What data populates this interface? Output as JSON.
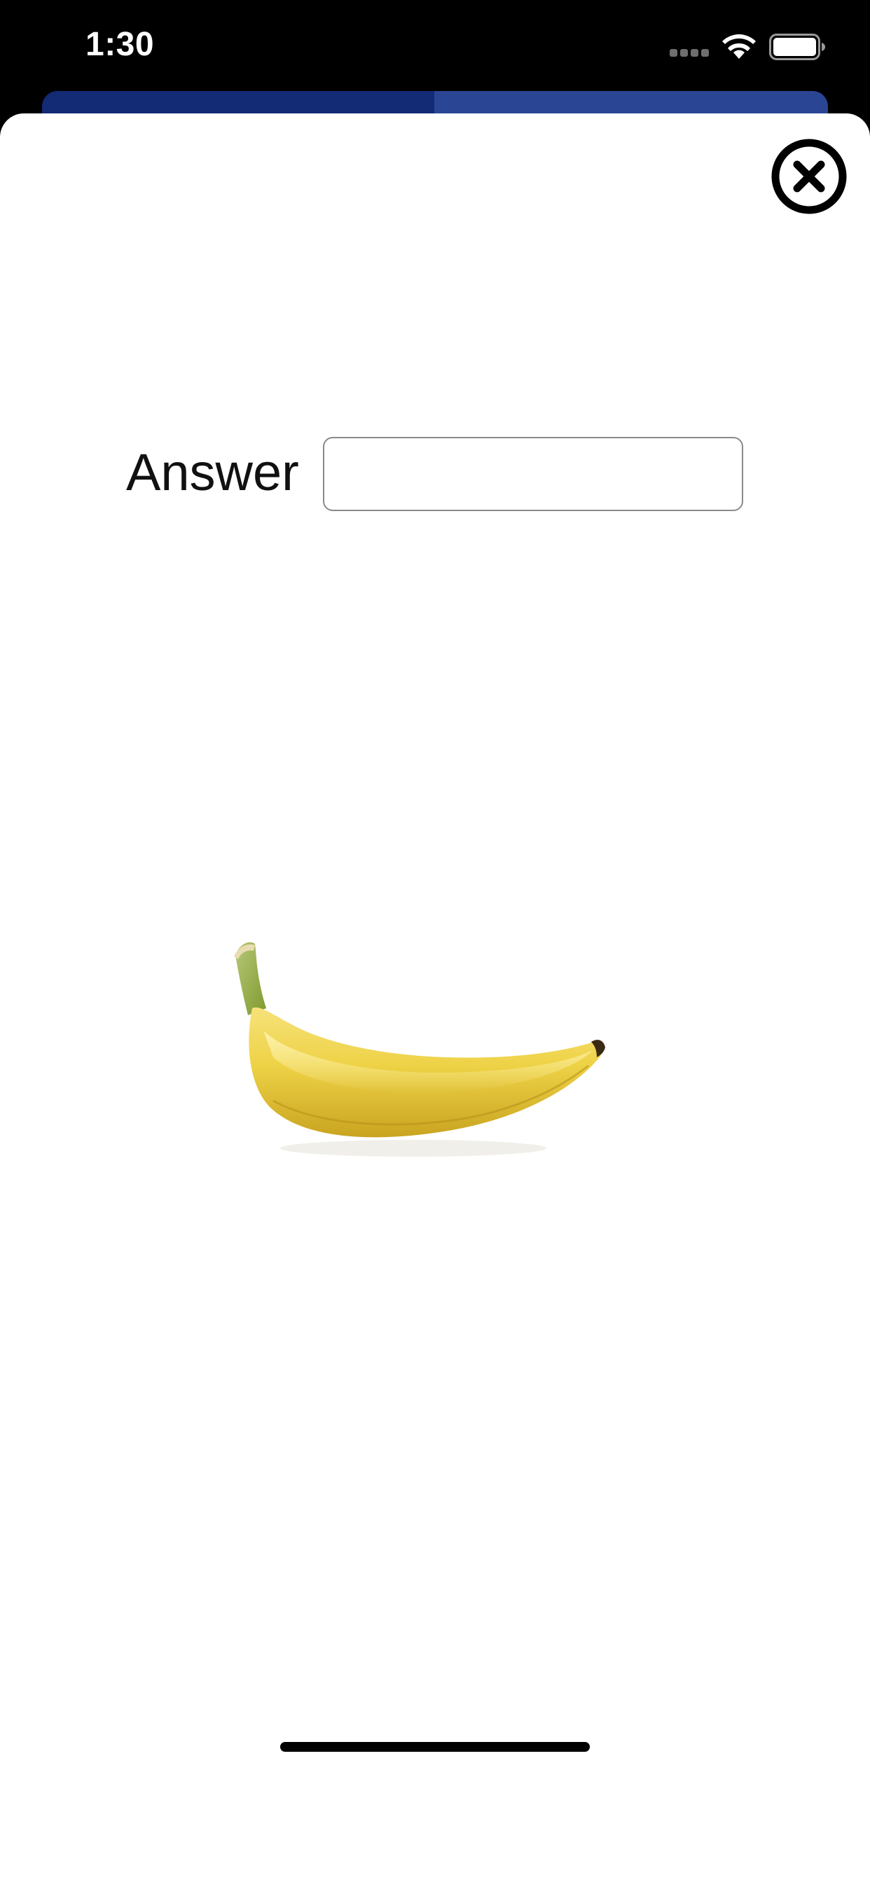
{
  "status_bar": {
    "time": "1:30",
    "icons": [
      "signal-icon",
      "wifi-icon",
      "battery-icon"
    ]
  },
  "background_sheet": {
    "colors": [
      "#132a74",
      "#2a4594"
    ]
  },
  "close_button": {
    "icon": "close-circle-icon"
  },
  "answer": {
    "label": "Answer",
    "value": "",
    "placeholder": ""
  },
  "image": {
    "subject": "banana-image"
  },
  "colors": {
    "status_bar_bg": "#000000",
    "sheet_bg": "#ffffff",
    "input_border": "#8a8a8a"
  }
}
